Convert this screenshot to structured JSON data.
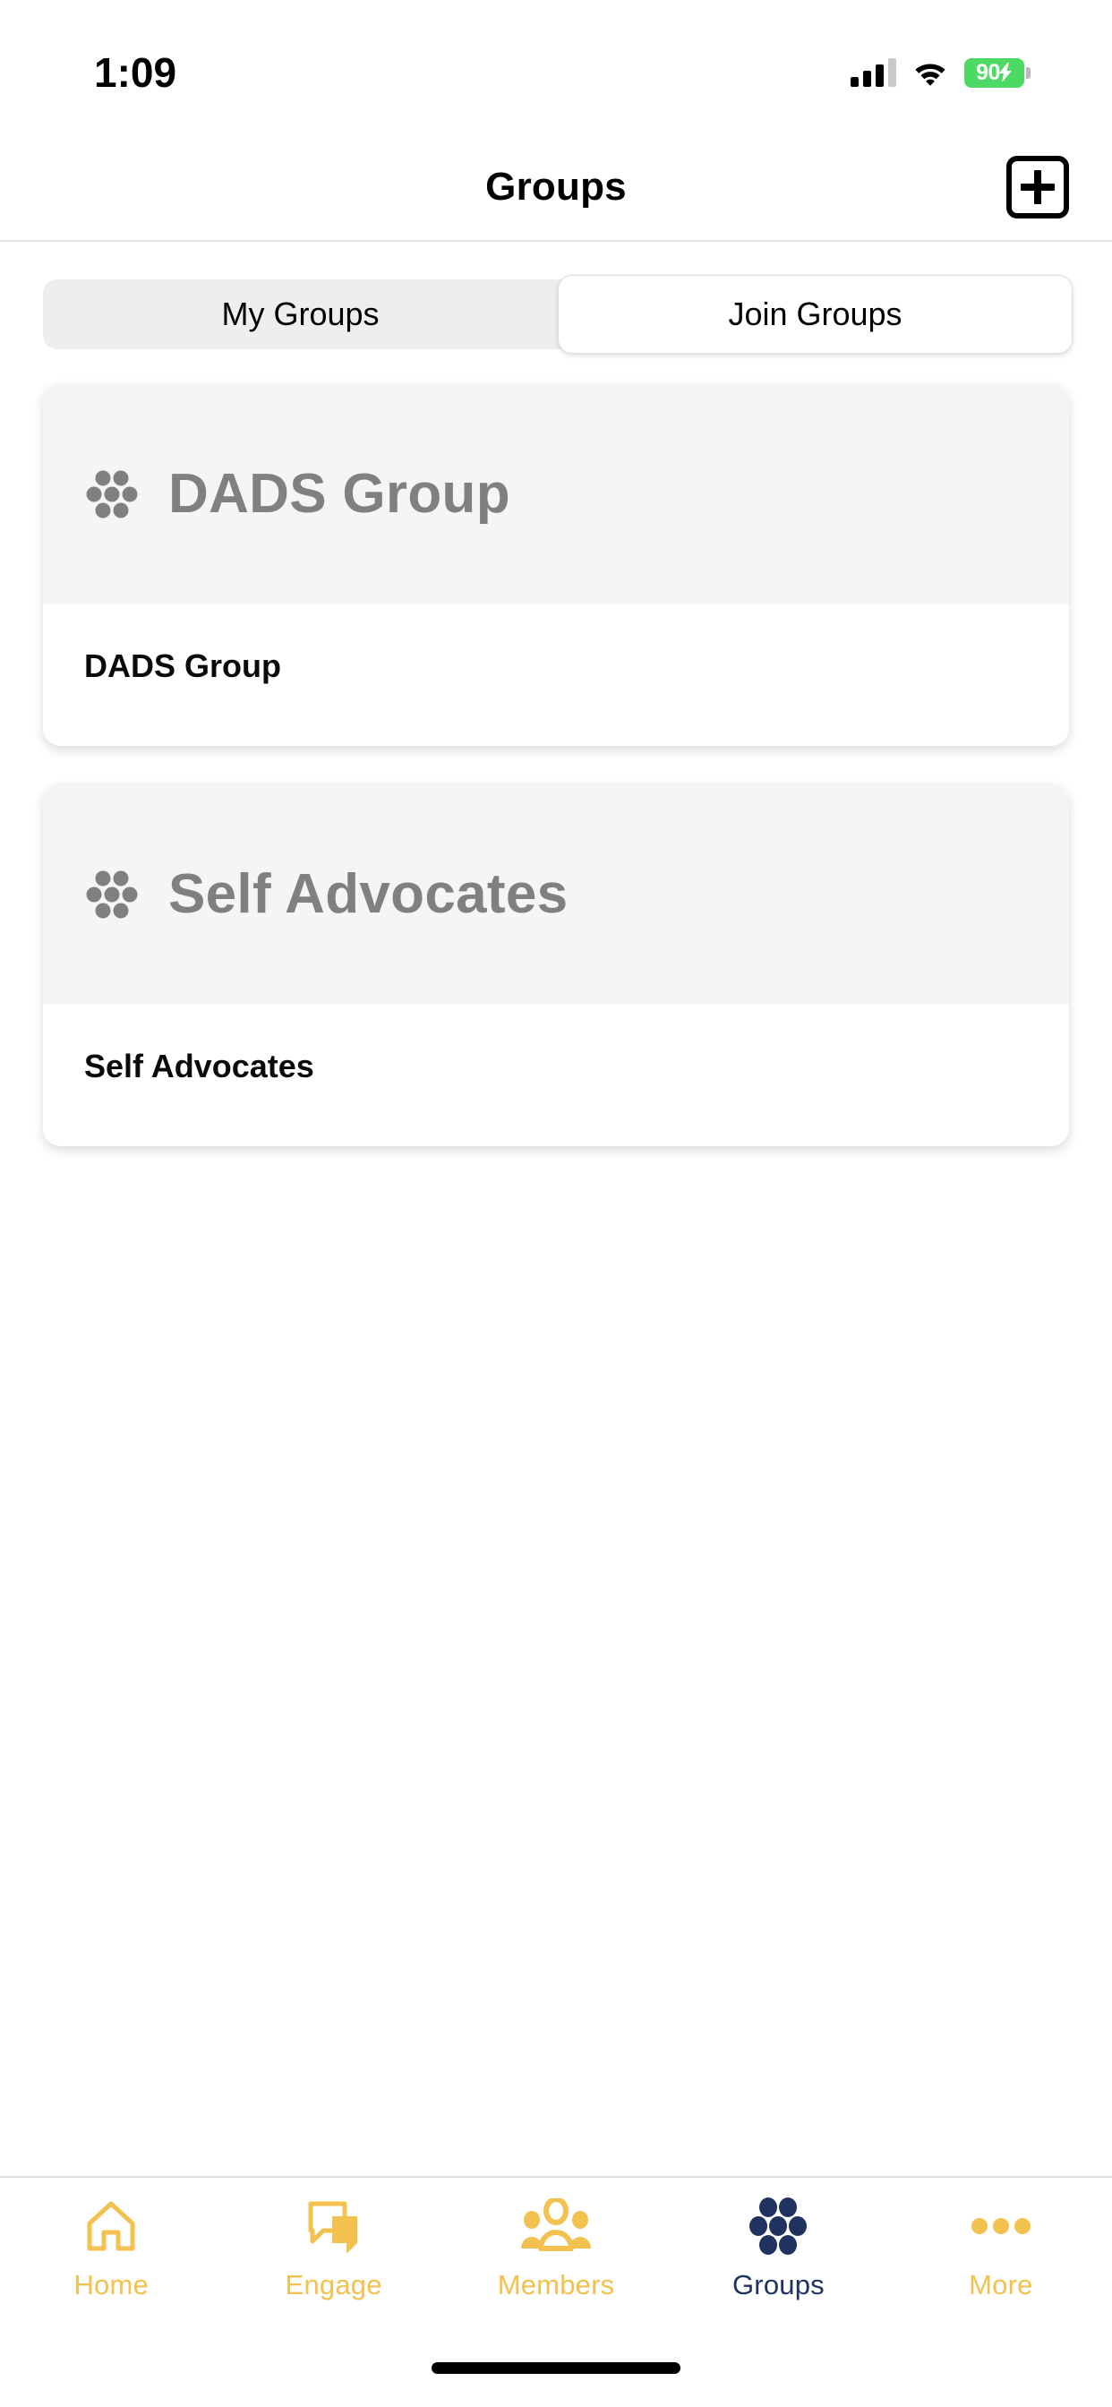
{
  "status_bar": {
    "time": "1:09",
    "battery_level": "90",
    "battery_charging": true,
    "battery_color": "#4CD964",
    "signal_bars_filled": 3,
    "signal_bars_total": 4,
    "wifi": "wifi-icon"
  },
  "header": {
    "title": "Groups",
    "add_button_icon": "plus-icon"
  },
  "segmented_control": {
    "options": [
      {
        "label": "My Groups",
        "selected": false
      },
      {
        "label": "Join Groups",
        "selected": true
      }
    ]
  },
  "groups": [
    {
      "header_title": "DADS Group",
      "body_title": "DADS Group",
      "icon": "group-cluster-icon"
    },
    {
      "header_title": "Self Advocates",
      "body_title": "Self Advocates",
      "icon": "group-cluster-icon"
    }
  ],
  "tab_bar": {
    "active_color": "#1F3260",
    "inactive_color": "#F2C14E",
    "items": [
      {
        "label": "Home",
        "icon": "home-icon",
        "active": false
      },
      {
        "label": "Engage",
        "icon": "chat-icon",
        "active": false
      },
      {
        "label": "Members",
        "icon": "people-icon",
        "active": false
      },
      {
        "label": "Groups",
        "icon": "group-cluster-icon",
        "active": true
      },
      {
        "label": "More",
        "icon": "ellipsis-icon",
        "active": false
      }
    ]
  }
}
